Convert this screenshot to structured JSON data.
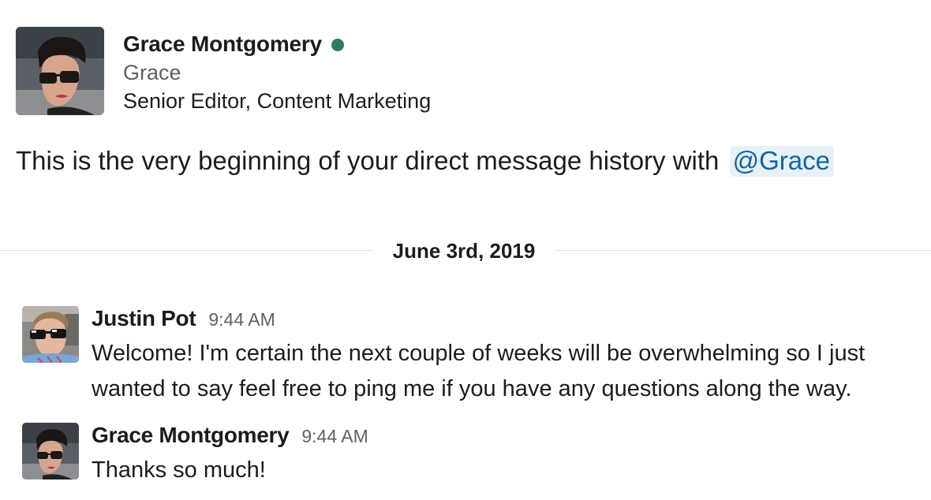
{
  "profile": {
    "full_name": "Grace Montgomery",
    "display_name": "Grace",
    "title": "Senior Editor, Content Marketing",
    "presence": "active",
    "presence_color": "#2e7d5b"
  },
  "intro": {
    "text": "This is the very beginning of your direct message history with",
    "mention": "@Grace"
  },
  "date_divider": {
    "label": "June 3rd, 2019"
  },
  "messages": [
    {
      "author": "Justin Pot",
      "time": "9:44 AM",
      "text": "Welcome! I'm certain the next couple of weeks will be overwhelming so I just wanted to say feel free to ping me if you have any questions along the way."
    },
    {
      "author": "Grace Montgomery",
      "time": "9:44 AM",
      "text": "Thanks so much!"
    }
  ],
  "colors": {
    "mention_text": "#1264a3",
    "mention_bg": "#e8f1f8",
    "timestamp": "#616061"
  }
}
